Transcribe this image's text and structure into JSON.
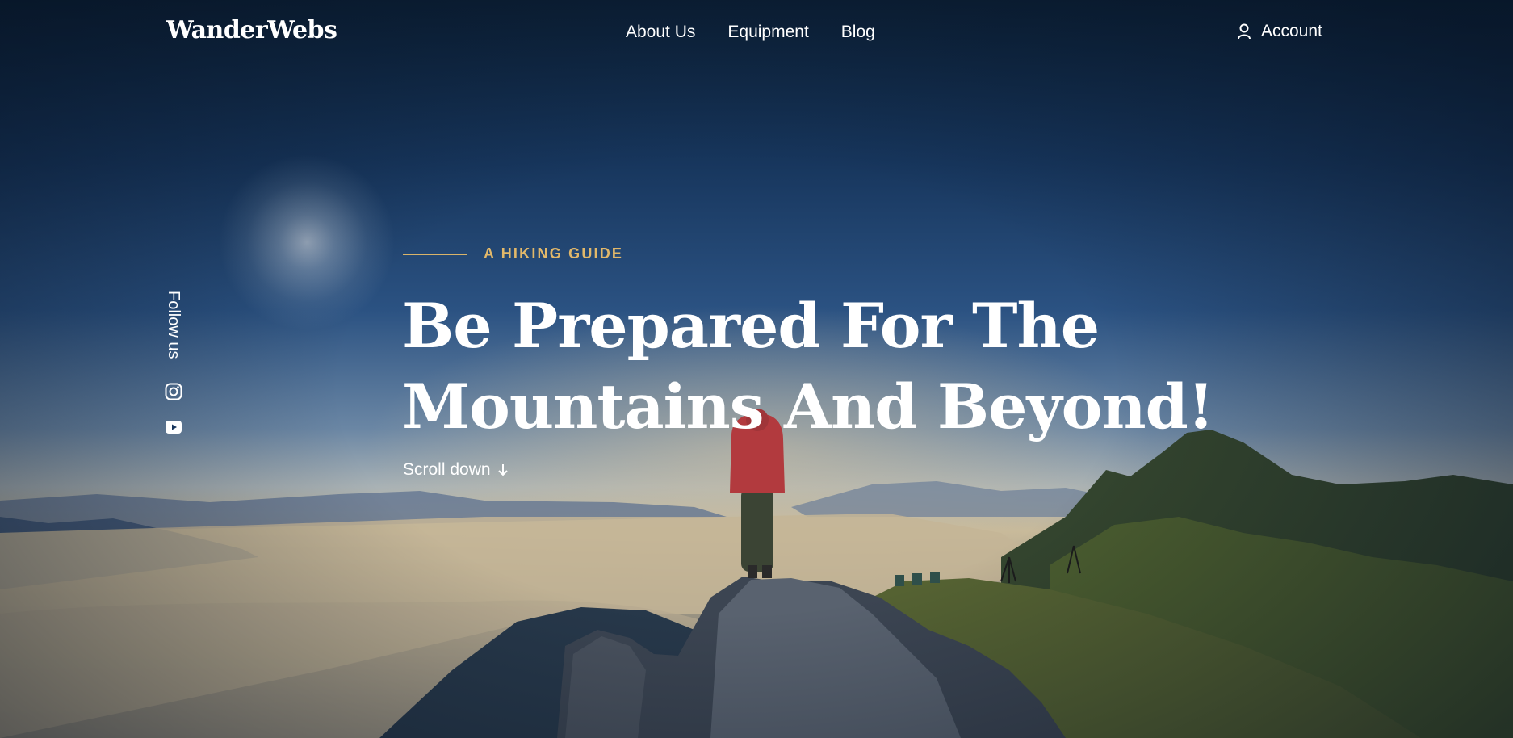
{
  "nav": {
    "logo": "WanderWebs",
    "menu": [
      {
        "label": "About Us"
      },
      {
        "label": "Equipment"
      },
      {
        "label": "Blog"
      }
    ],
    "account": {
      "label": "Account",
      "icon": "user-icon"
    }
  },
  "social": {
    "follow_label": "Follow us",
    "icons": [
      "instagram-icon",
      "youtube-icon"
    ]
  },
  "hero": {
    "eyebrow": "A HIKING GUIDE",
    "headline_line1": "Be Prepared For The",
    "headline_line2": "Mountains And Beyond!",
    "scroll_label": "Scroll down",
    "scroll_icon": "arrow-down-icon"
  },
  "colors": {
    "accent": "#e2b86a",
    "text": "#ffffff",
    "sky_top": "#0c2138"
  }
}
